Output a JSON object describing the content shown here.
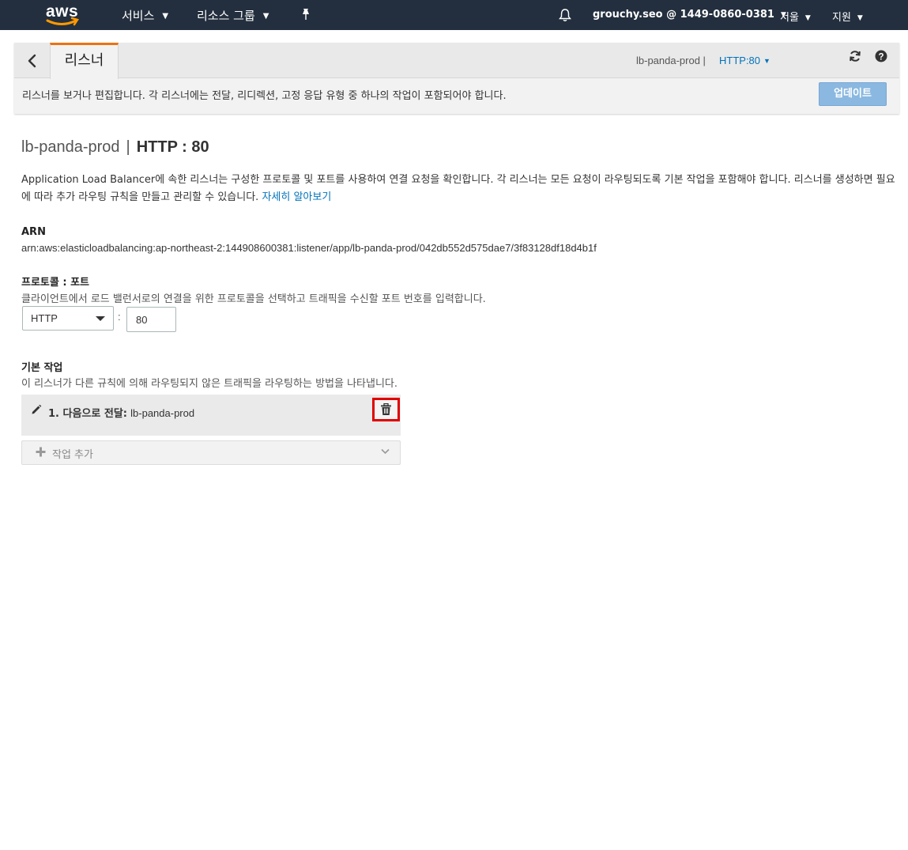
{
  "topnav": {
    "logo": "aws",
    "services_label": "서비스",
    "resource_groups_label": "리소스 그룹",
    "account_label": "grouchy.seo @ 1449-0860-0381",
    "region_label": "서울",
    "support_label": "지원",
    "icons": [
      "caret-down-icon",
      "pin-icon",
      "bell-icon"
    ]
  },
  "header": {
    "tab_label": "리스너",
    "crumb_lb": "lb-panda-prod |",
    "crumb_selector": "HTTP:80",
    "description": "리스너를 보거나 편집합니다. 각 리스너에는 전달, 리디렉션, 고정 응답 유형 중 하나의 작업이 포함되어야 합니다.",
    "update_label": "업데이트",
    "accent_color": "#ec7211",
    "icons": [
      "back-arrow-icon",
      "refresh-icon",
      "help-icon"
    ]
  },
  "main": {
    "title_lb": "lb-panda-prod",
    "title_sep": "|",
    "title_protocol": "HTTP : 80",
    "description": "Application Load Balancer에 속한 리스너는 구성한 프로토콜 및 포트를 사용하여 연결 요청을 확인합니다. 각 리스너는 모든 요청이 라우팅되도록 기본 작업을 포함해야 합니다. 리스너를 생성하면 필요에 따라 추가 라우팅 규칙을 만들고 관리할 수 있습니다.",
    "learn_more": "자세히 알아보기",
    "arn_label": "ARN",
    "arn_value": "arn:aws:elasticloadbalancing:ap-northeast-2:144908600381:listener/app/lb-panda-prod/042db552d575dae7/3f83128df18d4b1f",
    "protocol_port_label": "프로토콜 : 포트",
    "protocol_port_help": "클라이언트에서 로드 밸런서로의 연결을 위한 프로토콜을 선택하고 트래픽을 수신할 포트 번호를 입력합니다.",
    "protocol_value": "HTTP",
    "port_separator": ":",
    "port_value": "80",
    "default_action_label": "기본 작업",
    "default_action_help": "이 리스너가 다른 규칙에 의해 라우팅되지 않은 트래픽을 라우팅하는 방법을 나타냅니다.",
    "action_prefix": "1. 다음으로 전달:",
    "action_target": "lb-panda-prod",
    "add_action_label": "작업 추가",
    "highlight_color": "#e00000",
    "icons": [
      "pencil-icon",
      "trash-icon",
      "plus-icon",
      "chevron-down-icon"
    ]
  }
}
